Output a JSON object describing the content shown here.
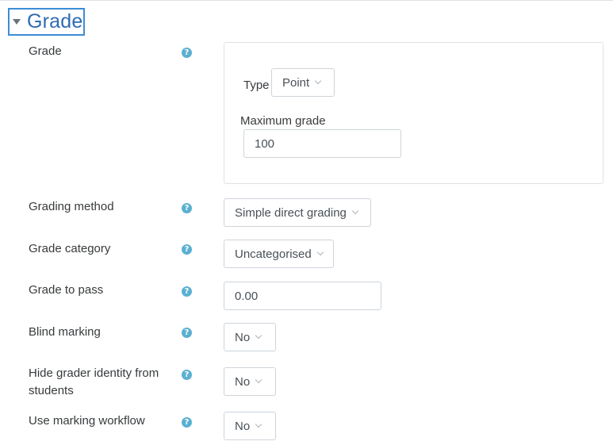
{
  "section": {
    "title": "Grade"
  },
  "grade": {
    "label": "Grade",
    "type_label": "Type",
    "type_value": "Point",
    "max_label": "Maximum grade",
    "max_value": "100"
  },
  "grading_method": {
    "label": "Grading method",
    "value": "Simple direct grading"
  },
  "grade_category": {
    "label": "Grade category",
    "value": "Uncategorised"
  },
  "grade_to_pass": {
    "label": "Grade to pass",
    "value": "0.00"
  },
  "blind_marking": {
    "label": "Blind marking",
    "value": "No"
  },
  "hide_grader": {
    "label_line1": "Hide grader identity from",
    "label_line2": "students",
    "value": "No"
  },
  "marking_workflow": {
    "label": "Use marking workflow",
    "value": "No"
  },
  "help_glyph": "?",
  "icons": {
    "help": "question-circle-icon",
    "collapse": "caret-down-icon",
    "dropdown": "chevron-down-icon"
  },
  "colors": {
    "accent": "#2f6bb2",
    "focus_border": "#3c8dd6",
    "help_icon": "#5bb0d1"
  }
}
